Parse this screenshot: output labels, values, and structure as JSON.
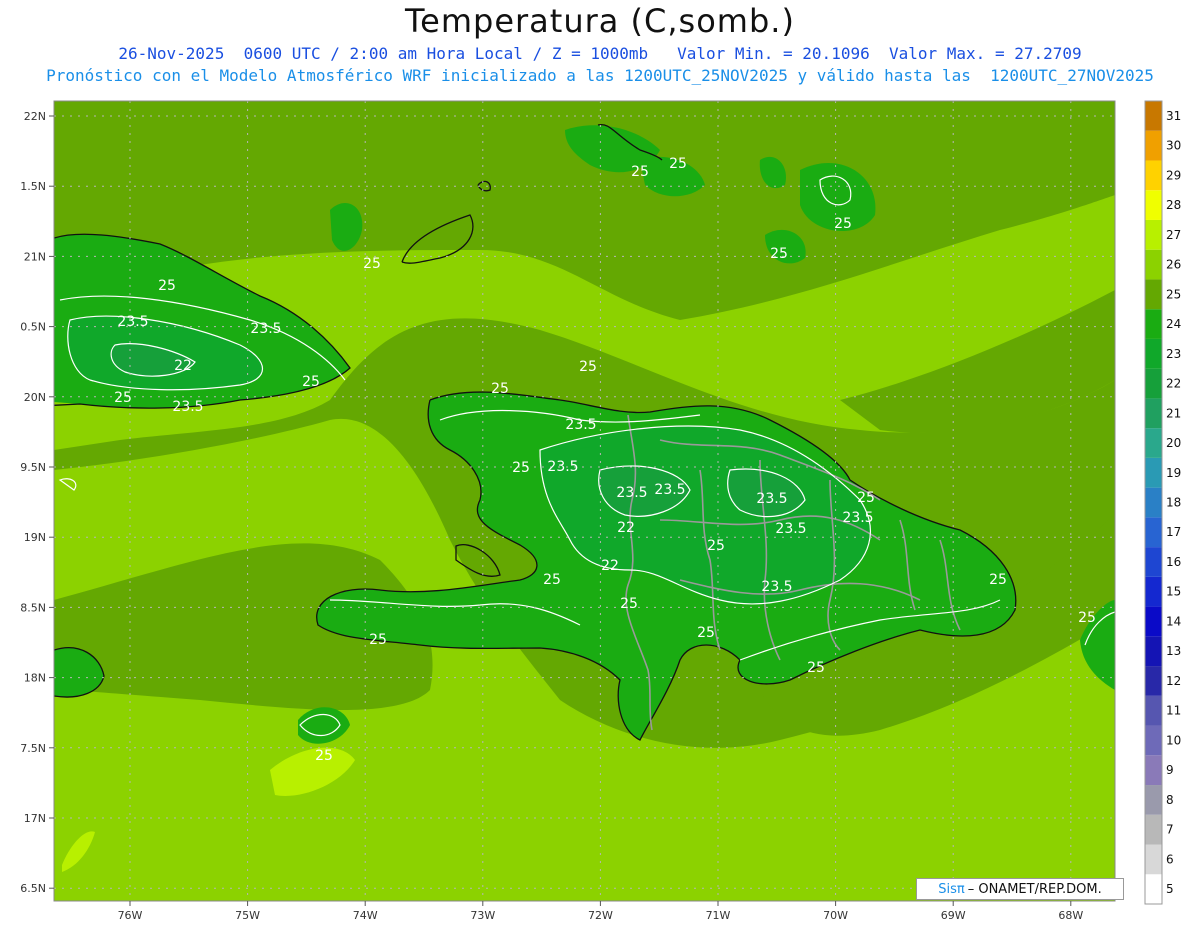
{
  "title": "Temperatura (C,somb.)",
  "subtitle_line1": "26-Nov-2025  0600 UTC / 2:00 am Hora Local / Z = 1000mb   Valor Min. = 20.1096  Valor Max. = 27.2709",
  "subtitle_line2": "Pronóstico con el Modelo Atmosférico WRF inicializado a las 1200UTC_25NOV2025 y válido hasta las  1200UTC_27NOV2025",
  "credit": {
    "brand": "Sisπ",
    "text": "– ONAMET/REP.DOM."
  },
  "lat_ticks": [
    "22N",
    "1.5N",
    "21N",
    "0.5N",
    "20N",
    "9.5N",
    "19N",
    "8.5N",
    "18N",
    "7.5N",
    "17N",
    "6.5N"
  ],
  "lon_ticks": [
    "76W",
    "75W",
    "74W",
    "73W",
    "72W",
    "71W",
    "70W",
    "69W",
    "68W"
  ],
  "contour_labels": [
    "25",
    "25",
    "25",
    "25",
    "25",
    "23.5",
    "23.5",
    "22",
    "23.5",
    "25",
    "25",
    "25",
    "23.5",
    "25",
    "23.5",
    "23.5",
    "25",
    "23.5",
    "22",
    "23.5",
    "22",
    "23.5",
    "23.5",
    "25",
    "25",
    "23.5",
    "25",
    "25",
    "25",
    "25",
    "25",
    "25",
    "25",
    "25",
    "25"
  ],
  "colorbar": [
    {
      "label": "5",
      "color": "#ffffff"
    },
    {
      "label": "6",
      "color": "#d8d8d8"
    },
    {
      "label": "7",
      "color": "#b8b8b8"
    },
    {
      "label": "8",
      "color": "#9a9aac"
    },
    {
      "label": "9",
      "color": "#8a7ab8"
    },
    {
      "label": "10",
      "color": "#6e6ab8"
    },
    {
      "label": "11",
      "color": "#5656b0"
    },
    {
      "label": "12",
      "color": "#2828a8"
    },
    {
      "label": "13",
      "color": "#1414b4"
    },
    {
      "label": "14",
      "color": "#0a0ac8"
    },
    {
      "label": "15",
      "color": "#1428d0"
    },
    {
      "label": "16",
      "color": "#1e46d2"
    },
    {
      "label": "17",
      "color": "#2864d2"
    },
    {
      "label": "18",
      "color": "#2a80c6"
    },
    {
      "label": "19",
      "color": "#2a9ab4"
    },
    {
      "label": "20",
      "color": "#2aa88c"
    },
    {
      "label": "21",
      "color": "#20a060"
    },
    {
      "label": "22",
      "color": "#16a03a"
    },
    {
      "label": "23",
      "color": "#10a82a"
    },
    {
      "label": "24",
      "color": "#1aac12"
    },
    {
      "label": "25",
      "color": "#64a802"
    },
    {
      "label": "26",
      "color": "#8cd200"
    },
    {
      "label": "27",
      "color": "#b8f000"
    },
    {
      "label": "28",
      "color": "#f0ff00"
    },
    {
      "label": "29",
      "color": "#ffd200"
    },
    {
      "label": "30",
      "color": "#f0a000"
    },
    {
      "label": "31",
      "color": "#c87800"
    }
  ],
  "colors": {
    "band_24_25": "#64a802",
    "band_25_26": "#8cd200",
    "band_26_27": "#b8f000",
    "band_23_24": "#1aac12",
    "band_22_23": "#10a82a",
    "band_21_22": "#16a03a",
    "contour": "#ffffff",
    "coast": "#111111",
    "border": "#9a9a9a"
  }
}
